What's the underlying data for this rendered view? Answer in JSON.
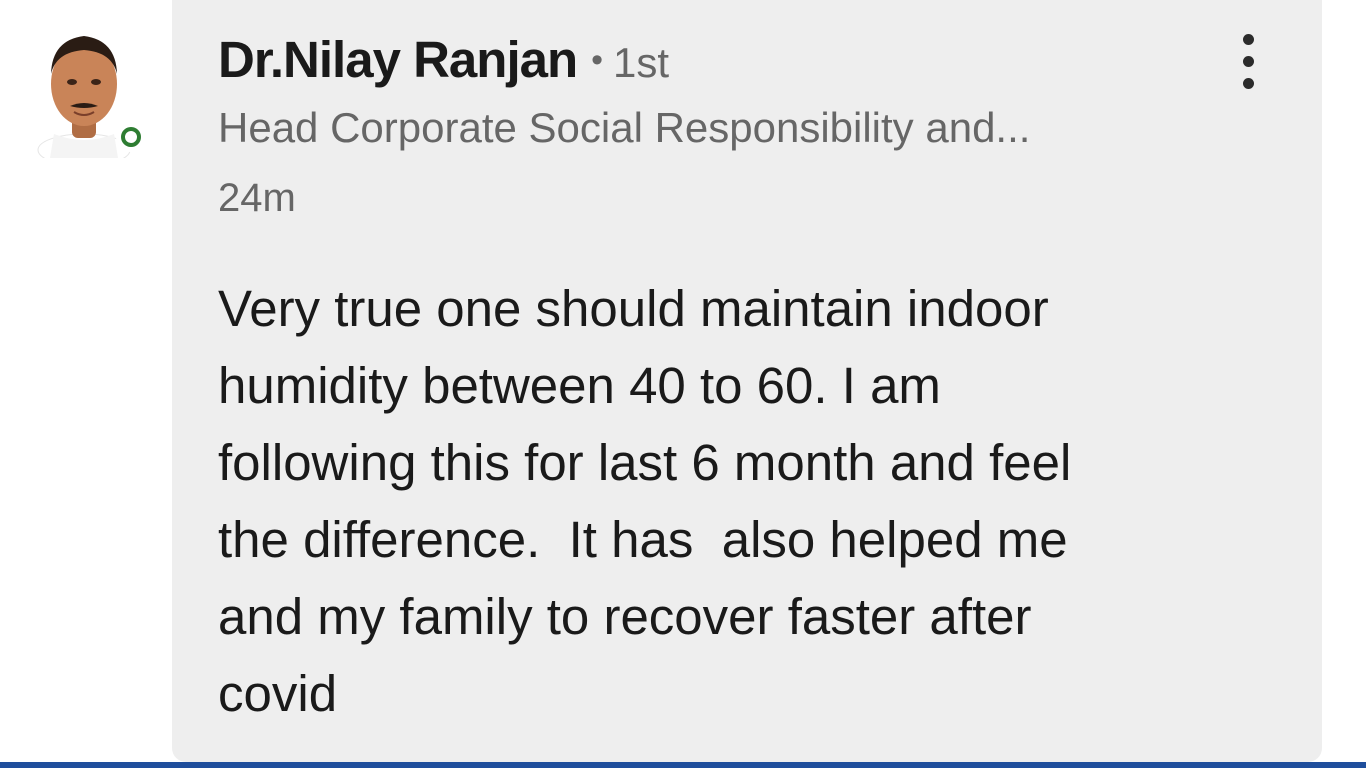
{
  "comment": {
    "author_name": "Dr.Nilay Ranjan",
    "separator": "•",
    "connection_degree": "1st",
    "headline": "Head Corporate Social Responsibility and...",
    "timestamp": "24m",
    "body_lines": [
      "Very true one should maintain indoor",
      "humidity between 40 to 60. I am",
      "following this for last 6 month and feel",
      "the difference.  It has  also helped me",
      "and my family to recover faster after",
      "covid"
    ]
  },
  "icons": {
    "more": "more-vertical-icon",
    "presence": "online-status-icon"
  },
  "colors": {
    "bubble_background": "#eeeeee",
    "presence_green": "#2e7d32",
    "bottom_bar": "#1f4e9c",
    "secondary_text": "#666666",
    "primary_text": "#1a1a1a"
  }
}
